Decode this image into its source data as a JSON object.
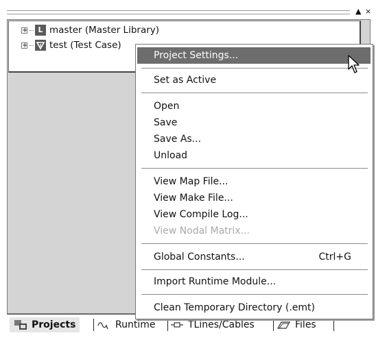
{
  "window": {
    "dock_button": "▲",
    "close_button": "×"
  },
  "tree": {
    "items": [
      {
        "expander": "+",
        "icon": "L",
        "label": "master (Master Library)"
      },
      {
        "expander": "+",
        "icon": "T",
        "label": "test (Test Case)"
      }
    ]
  },
  "context_menu": {
    "items": [
      {
        "label": "Project Settings...",
        "state": "highlighted"
      },
      {
        "label": "Set as Active"
      },
      {
        "label": "Open"
      },
      {
        "label": "Save"
      },
      {
        "label": "Save As..."
      },
      {
        "label": "Unload"
      },
      {
        "label": "View Map File..."
      },
      {
        "label": "View Make File..."
      },
      {
        "label": "View Compile Log..."
      },
      {
        "label": "View Nodal Matrix...",
        "state": "disabled"
      },
      {
        "label": "Global Constants...",
        "shortcut": "Ctrl+G"
      },
      {
        "label": "Import Runtime Module..."
      },
      {
        "label": "Clean Temporary Directory (.emt)"
      }
    ]
  },
  "tabs": [
    {
      "label": "Projects",
      "icon": "projects-icon",
      "active": true
    },
    {
      "label": "Runtime",
      "icon": "runtime-wave-icon"
    },
    {
      "label": "TLines/Cables",
      "icon": "tline-icon"
    },
    {
      "label": "Files",
      "icon": "files-icon"
    }
  ],
  "colors": {
    "panel_bg": "#d4d4d4",
    "menu_highlight": "#6d6d6d",
    "disabled_text": "#a9a9a9"
  }
}
